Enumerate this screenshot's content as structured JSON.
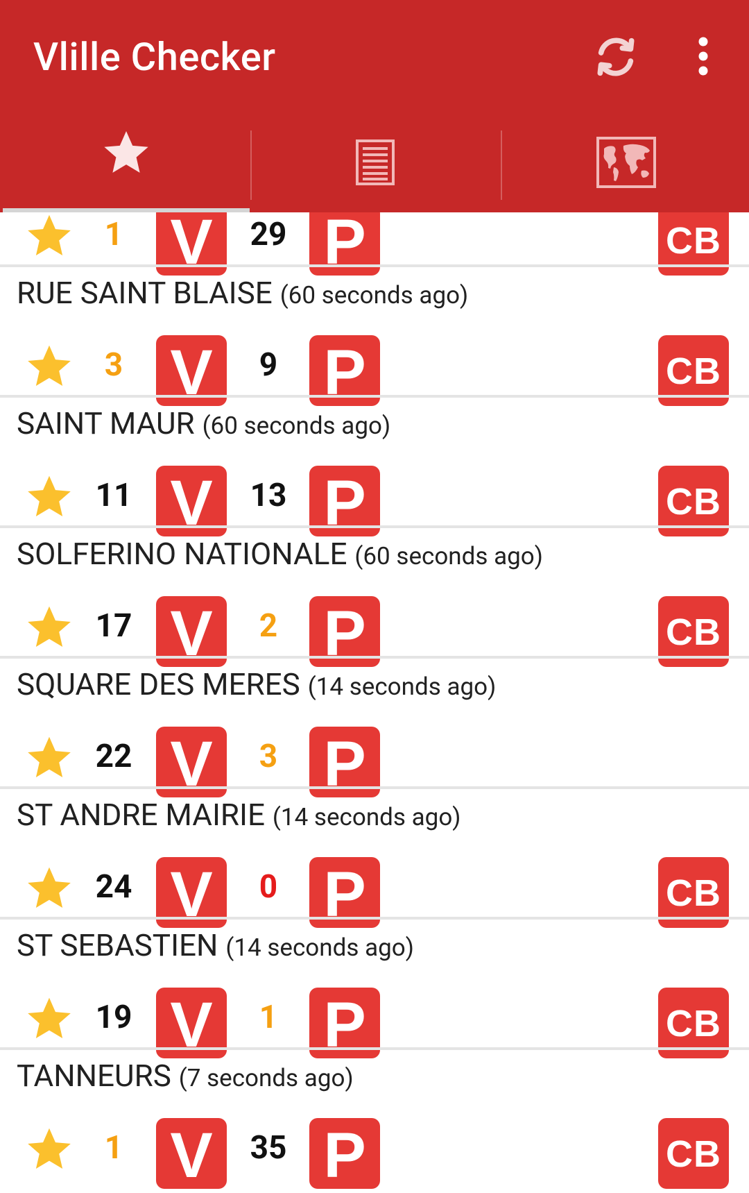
{
  "app": {
    "title": "Vlille Checker"
  },
  "toolbar": {
    "refresh_icon": "refresh-icon",
    "menu_icon": "more-vert-icon"
  },
  "tabs": [
    {
      "icon": "star-icon",
      "selected": true
    },
    {
      "icon": "list-icon",
      "selected": false
    },
    {
      "icon": "map-icon",
      "selected": false
    }
  ],
  "colors": {
    "appbar": "#c62828",
    "badge": "#e53935",
    "star": "#fbc02d",
    "low": "#f5a012",
    "zero": "#e51c1c"
  },
  "badges": {
    "bikes": "V",
    "slots": "P",
    "card": "CB"
  },
  "stations": [
    {
      "name": "",
      "ago": "",
      "bikes": "1",
      "slots": "29",
      "bikes_state": "low",
      "slots_state": "normal",
      "card": true
    },
    {
      "name": "RUE SAINT BLAISE",
      "ago": "(60 seconds ago)",
      "bikes": "3",
      "slots": "9",
      "bikes_state": "low",
      "slots_state": "normal",
      "card": true
    },
    {
      "name": "SAINT MAUR",
      "ago": "(60 seconds ago)",
      "bikes": "11",
      "slots": "13",
      "bikes_state": "normal",
      "slots_state": "normal",
      "card": true
    },
    {
      "name": "SOLFERINO NATIONALE",
      "ago": "(60 seconds ago)",
      "bikes": "17",
      "slots": "2",
      "bikes_state": "normal",
      "slots_state": "low",
      "card": true
    },
    {
      "name": "SQUARE DES MERES",
      "ago": "(14 seconds ago)",
      "bikes": "22",
      "slots": "3",
      "bikes_state": "normal",
      "slots_state": "low",
      "card": false
    },
    {
      "name": "ST ANDRE MAIRIE",
      "ago": "(14 seconds ago)",
      "bikes": "24",
      "slots": "0",
      "bikes_state": "normal",
      "slots_state": "zero",
      "card": true
    },
    {
      "name": "ST SEBASTIEN",
      "ago": "(14 seconds ago)",
      "bikes": "19",
      "slots": "1",
      "bikes_state": "normal",
      "slots_state": "low",
      "card": true
    },
    {
      "name": "TANNEURS",
      "ago": "(7 seconds ago)",
      "bikes": "1",
      "slots": "35",
      "bikes_state": "low",
      "slots_state": "normal",
      "card": true
    }
  ]
}
